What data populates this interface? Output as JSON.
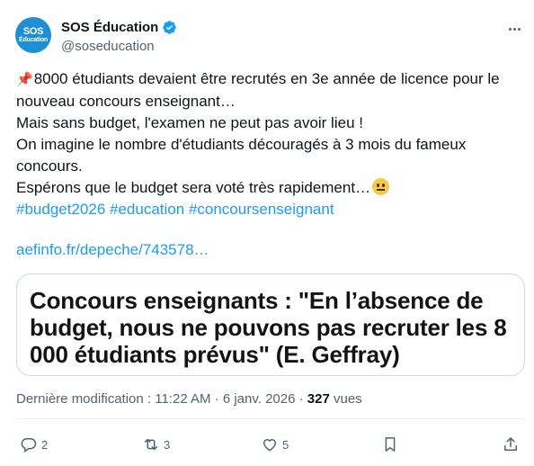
{
  "author": {
    "avatar_line1": "SOS",
    "avatar_line2": "Éducation",
    "display_name": "SOS Éducation",
    "handle": "@soseducation",
    "verified": true
  },
  "tweet": {
    "lines": [
      "8000 étudiants devaient être recrutés en 3e année de licence pour le",
      "nouveau concours enseignant…",
      "Mais sans budget, l'examen ne peut pas avoir lieu !",
      "On imagine le nombre d'étudiants découragés à 3 mois du fameux",
      "concours.",
      "Espérons que le budget sera voté très rapidement…"
    ],
    "hashtags": [
      "#budget2026",
      "#education",
      "#concoursenseignant"
    ],
    "link_text": "aefinfo.fr/depeche/743578…"
  },
  "card": {
    "headline": "Concours enseignants : \"En l’absence de budget, nous ne pouvons pas recruter les 8 000 étudiants prévus\" (E. Geffray)"
  },
  "meta": {
    "modified_label": "Dernière modification : 11:22 AM · 6 janv. 2026 · ",
    "views_count": "327",
    "views_label": " vues"
  },
  "actions": {
    "replies": "2",
    "reposts": "3",
    "likes": "5"
  },
  "icons": {
    "pin": "pushpin-icon",
    "emoji": "neutral-face-icon",
    "verified": "verified-badge-icon",
    "more": "more-icon"
  },
  "colors": {
    "link": "#1d9bf0",
    "secondary_text": "#536471",
    "avatar_bg": "#1d8fd3"
  }
}
